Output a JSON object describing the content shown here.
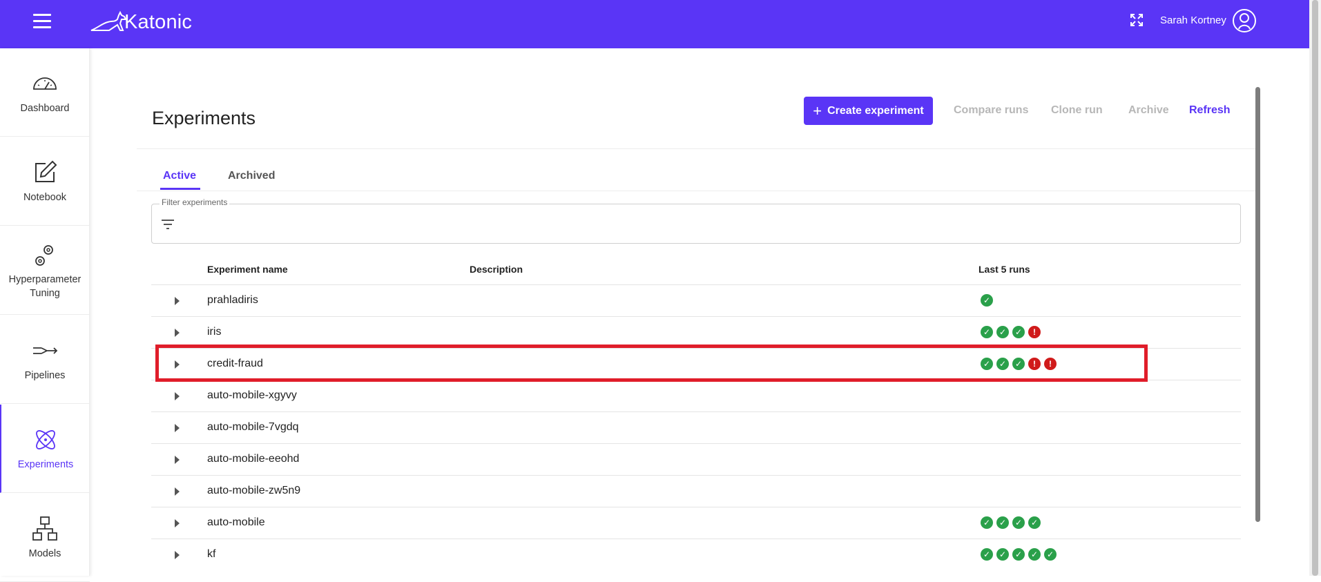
{
  "app": {
    "brand": "Katonic",
    "user_name": "Sarah Kortney"
  },
  "sidebar": {
    "items": [
      {
        "label": "Dashboard"
      },
      {
        "label": "Notebook"
      },
      {
        "label": "Hyperparameter\nTuning"
      },
      {
        "label": "Pipelines"
      },
      {
        "label": "Experiments"
      },
      {
        "label": "Models"
      }
    ]
  },
  "page": {
    "title": "Experiments",
    "actions": {
      "create": "Create experiment",
      "compare": "Compare runs",
      "clone": "Clone run",
      "archive": "Archive",
      "refresh": "Refresh"
    },
    "tabs": {
      "active": "Active",
      "archived": "Archived"
    },
    "filter": {
      "label": "Filter experiments",
      "value": ""
    }
  },
  "table": {
    "headers": {
      "name": "Experiment name",
      "description": "Description",
      "runs": "Last 5 runs"
    },
    "rows": [
      {
        "name": "prahladiris",
        "description": "",
        "runs": [
          "ok"
        ]
      },
      {
        "name": "iris",
        "description": "",
        "runs": [
          "ok",
          "ok",
          "ok",
          "err"
        ]
      },
      {
        "name": "credit-fraud",
        "description": "",
        "runs": [
          "ok",
          "ok",
          "ok",
          "err",
          "err"
        ]
      },
      {
        "name": "auto-mobile-xgyvy",
        "description": "",
        "runs": []
      },
      {
        "name": "auto-mobile-7vgdq",
        "description": "",
        "runs": []
      },
      {
        "name": "auto-mobile-eeohd",
        "description": "",
        "runs": []
      },
      {
        "name": "auto-mobile-zw5n9",
        "description": "",
        "runs": []
      },
      {
        "name": "auto-mobile",
        "description": "",
        "runs": [
          "ok",
          "ok",
          "ok",
          "ok"
        ]
      },
      {
        "name": "kf",
        "description": "",
        "runs": [
          "ok",
          "ok",
          "ok",
          "ok",
          "ok"
        ]
      }
    ]
  },
  "colors": {
    "accent": "#5a35f6",
    "success": "#2aa04a",
    "error": "#d01b1b",
    "highlight": "#e01d2a"
  }
}
